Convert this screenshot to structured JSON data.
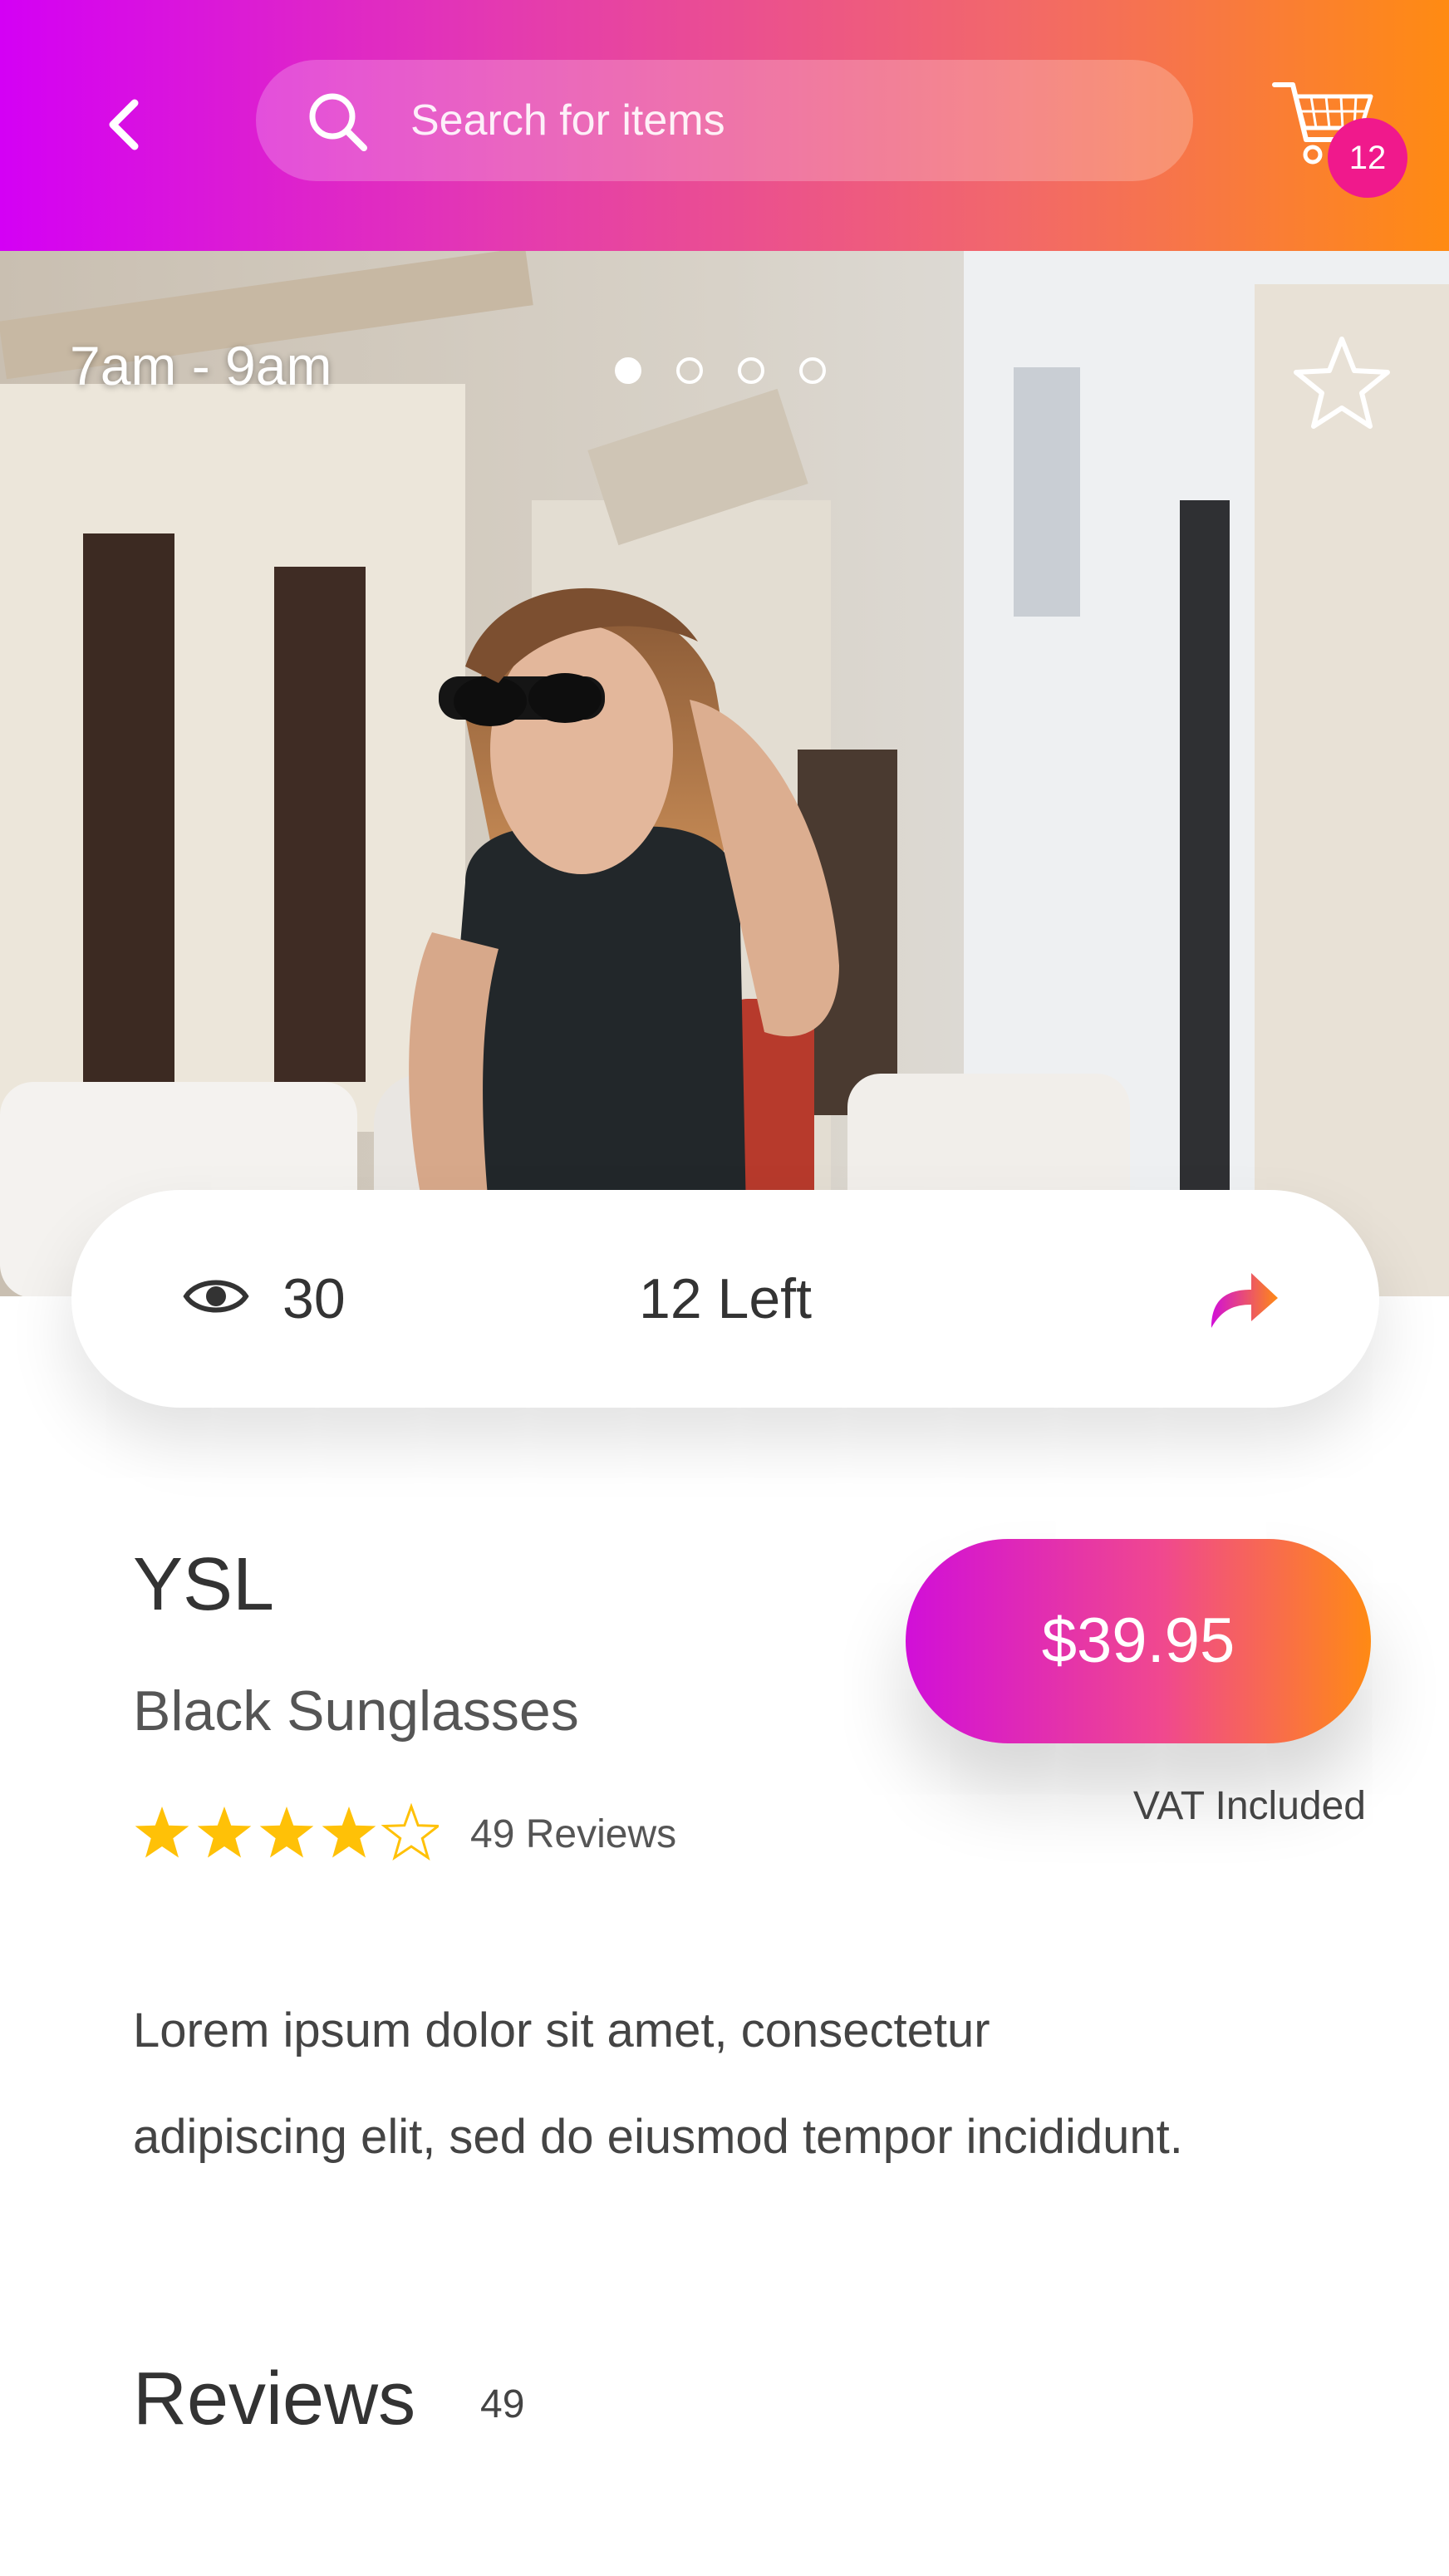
{
  "header": {
    "search_placeholder": "Search for items",
    "cart_count": "12",
    "gradient": [
      "#d400f5",
      "#ff8b12"
    ]
  },
  "hero": {
    "time_range": "7am - 9am",
    "carousel_pages": 4,
    "carousel_active": 1
  },
  "stats": {
    "views": "30",
    "stock_left": "12 Left"
  },
  "product": {
    "brand": "YSL",
    "name": "Black Sunglasses",
    "rating": 4,
    "rating_max": 5,
    "reviews_label": "49 Reviews",
    "price": "$39.95",
    "vat_note": "VAT Included",
    "description_line1": "Lorem ipsum dolor sit amet, consectetur",
    "description_line2": "adipiscing elit, sed do eiusmod tempor incididunt."
  },
  "reviews": {
    "title": "Reviews",
    "count": "49"
  },
  "colors": {
    "star": "#ffc107",
    "badge": "#f0198c",
    "accent_orange": "#ff8a14",
    "accent_magenta": "#d10fd8"
  }
}
